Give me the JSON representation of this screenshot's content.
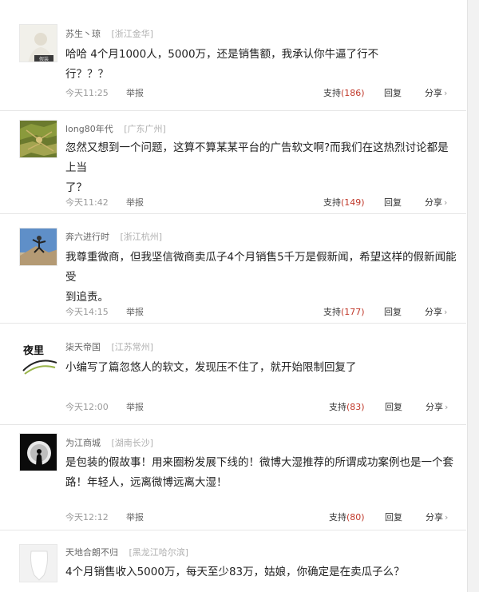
{
  "comments": [
    {
      "user": "苏生丶琼",
      "location": "[浙江金华]",
      "text_lines": [
        "哈哈 4个月1000人，5000万，还是销售额，我承认你牛逼了行不行？？？"
      ],
      "avatar_text": "假装",
      "time": "今天11:25",
      "report": "举报",
      "support_label": "支持",
      "support_count": "(186)",
      "reply": "回复",
      "share": "分享",
      "share_chevron": "›"
    },
    {
      "user": "long80年代",
      "location": "[广东广州]",
      "text_lines": [
        "忽然又想到一个问题，这算不算某某平台的广告软文啊?而我们在这热烈讨论都是上当",
        "了？"
      ],
      "avatar_text": "",
      "time": "今天11:42",
      "report": "举报",
      "support_label": "支持",
      "support_count": "(149)",
      "reply": "回复",
      "share": "分享",
      "share_chevron": "›"
    },
    {
      "user": "奔六进行时",
      "location": "[浙江杭州]",
      "text_lines": [
        "我尊重微商，但我坚信微商卖瓜子4个月销售5千万是假新闻，希望这样的假新闻能受",
        "到追责。"
      ],
      "avatar_text": "",
      "time": "今天14:15",
      "report": "举报",
      "support_label": "支持",
      "support_count": "(177)",
      "reply": "回复",
      "share": "分享",
      "share_chevron": "›"
    },
    {
      "user": "柒天帝国",
      "location": "[江苏常州]",
      "text_lines": [
        "小编写了篇忽悠人的软文，发现压不住了，就开始限制回复了"
      ],
      "avatar_text": "夜里",
      "time": "今天12:00",
      "report": "举报",
      "support_label": "支持",
      "support_count": "(83)",
      "reply": "回复",
      "share": "分享",
      "share_chevron": "›"
    },
    {
      "user": "为江商城",
      "location": "[湖南长沙]",
      "text_lines": [
        "是包装的假故事！用来圈粉发展下线的！微博大湿推荐的所谓成功案例也是一个套",
        "路！年轻人，远离微博远离大湿！"
      ],
      "avatar_text": "",
      "time": "今天12:12",
      "report": "举报",
      "support_label": "支持",
      "support_count": "(80)",
      "reply": "回复",
      "share": "分享",
      "share_chevron": "›"
    },
    {
      "user": "天地合朗不归",
      "location": "[黑龙江哈尔滨]",
      "text_lines": [
        "4个月销售收入5000万，每天至少83万，姑娘，你确定是在卖瓜子么？"
      ],
      "avatar_text": "",
      "time": "",
      "report": "",
      "support_label": "",
      "support_count": "",
      "reply": "",
      "share": "",
      "share_chevron": ""
    }
  ]
}
